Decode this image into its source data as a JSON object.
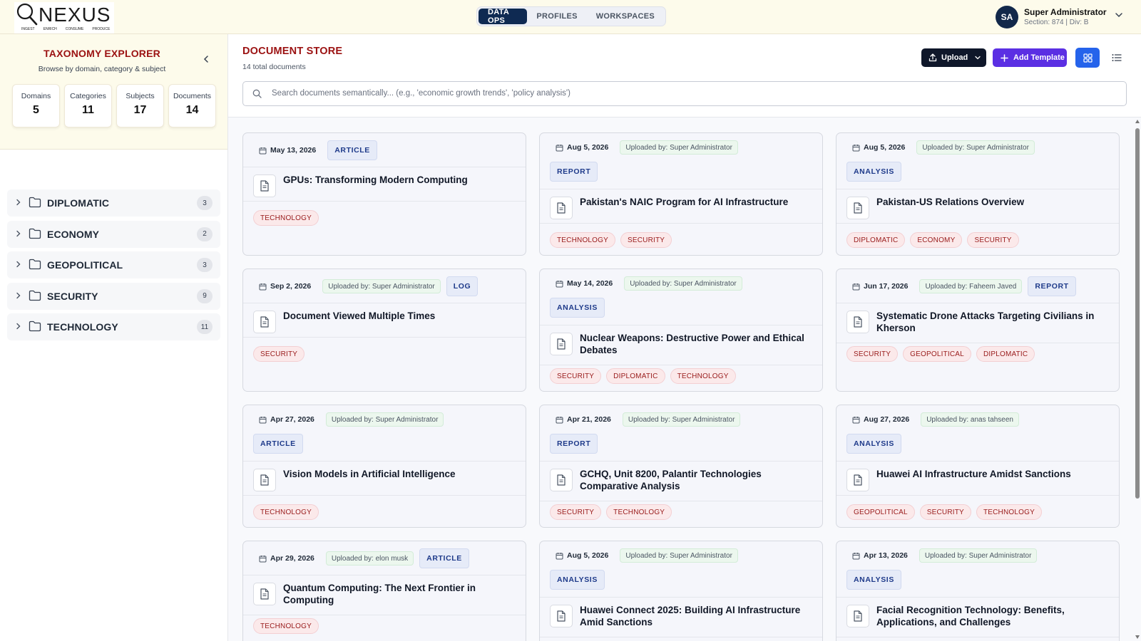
{
  "header": {
    "logo": {
      "name": "NEXUS",
      "tagline": [
        "INGEST",
        "ENRICH",
        "CONSUME",
        "PRODUCE"
      ]
    },
    "tabs": [
      {
        "label": "DATA OPS",
        "active": true
      },
      {
        "label": "PROFILES",
        "active": false
      },
      {
        "label": "WORKSPACES",
        "active": false
      }
    ],
    "user": {
      "initials": "SA",
      "name": "Super Administrator",
      "meta": "Section: 874 | Div: B"
    }
  },
  "sidebar": {
    "title": "TAXONOMY EXPLORER",
    "subtitle": "Browse by domain, category & subject",
    "stats": [
      {
        "label": "Domains",
        "value": "5"
      },
      {
        "label": "Categories",
        "value": "11"
      },
      {
        "label": "Subjects",
        "value": "17"
      },
      {
        "label": "Documents",
        "value": "14"
      }
    ],
    "domains": [
      {
        "label": "DIPLOMATIC",
        "count": "3"
      },
      {
        "label": "ECONOMY",
        "count": "2"
      },
      {
        "label": "GEOPOLITICAL",
        "count": "3"
      },
      {
        "label": "SECURITY",
        "count": "9"
      },
      {
        "label": "TECHNOLOGY",
        "count": "11"
      }
    ]
  },
  "main": {
    "title": "DOCUMENT STORE",
    "count_text": "14 total documents",
    "upload_label": "Upload",
    "add_template_label": "Add Template",
    "search": {
      "placeholder": "Search documents semantically... (e.g., 'economic growth trends', 'policy analysis')",
      "value": ""
    }
  },
  "colors": {
    "brand_red": "#9b1111",
    "nav_active": "#0f2a52",
    "primary": "#2563eb",
    "accent_purple": "#5b2fe3",
    "tag_red": "#991b1b"
  },
  "documents": [
    {
      "date": "May 13, 2026",
      "uploader": "",
      "type": "ARTICLE",
      "type_inline": true,
      "title": "GPUs: Transforming Modern Computing",
      "tags": [
        "TECHNOLOGY"
      ]
    },
    {
      "date": "Aug 5, 2026",
      "uploader": "Uploaded by: Super Administrator",
      "type": "REPORT",
      "type_inline": false,
      "title": "Pakistan's NAIC Program for AI Infrastructure",
      "tags": [
        "TECHNOLOGY",
        "SECURITY"
      ]
    },
    {
      "date": "Aug 5, 2026",
      "uploader": "Uploaded by: Super Administrator",
      "type": "ANALYSIS",
      "type_inline": false,
      "title": "Pakistan-US Relations Overview",
      "tags": [
        "DIPLOMATIC",
        "ECONOMY",
        "SECURITY"
      ]
    },
    {
      "date": "Sep 2, 2026",
      "uploader": "Uploaded by: Super Administrator",
      "type": "LOG",
      "type_inline": true,
      "title": "Document Viewed Multiple Times",
      "tags": [
        "SECURITY"
      ]
    },
    {
      "date": "May 14, 2026",
      "uploader": "Uploaded by: Super Administrator",
      "type": "ANALYSIS",
      "type_inline": false,
      "title": "Nuclear Weapons: Destructive Power and Ethical Debates",
      "tags": [
        "SECURITY",
        "DIPLOMATIC",
        "TECHNOLOGY"
      ]
    },
    {
      "date": "Jun 17, 2026",
      "uploader": "Uploaded by: Faheem Javed",
      "type": "REPORT",
      "type_inline": true,
      "title": "Systematic Drone Attacks Targeting Civilians in Kherson",
      "tags": [
        "SECURITY",
        "GEOPOLITICAL",
        "DIPLOMATIC"
      ]
    },
    {
      "date": "Apr 27, 2026",
      "uploader": "Uploaded by: Super Administrator",
      "type": "ARTICLE",
      "type_inline": false,
      "title": "Vision Models in Artificial Intelligence",
      "tags": [
        "TECHNOLOGY"
      ]
    },
    {
      "date": "Apr 21, 2026",
      "uploader": "Uploaded by: Super Administrator",
      "type": "REPORT",
      "type_inline": false,
      "title": "GCHQ, Unit 8200, Palantir Technologies Comparative Analysis",
      "tags": [
        "SECURITY",
        "TECHNOLOGY"
      ]
    },
    {
      "date": "Aug 27, 2026",
      "uploader": "Uploaded by: anas tahseen",
      "type": "ANALYSIS",
      "type_inline": false,
      "title": "Huawei AI Infrastructure Amidst Sanctions",
      "tags": [
        "GEOPOLITICAL",
        "SECURITY",
        "TECHNOLOGY"
      ]
    },
    {
      "date": "Apr 29, 2026",
      "uploader": "Uploaded by: elon musk",
      "type": "ARTICLE",
      "type_inline": true,
      "title": "Quantum Computing: The Next Frontier in Computing",
      "tags": [
        "TECHNOLOGY"
      ]
    },
    {
      "date": "Aug 5, 2026",
      "uploader": "Uploaded by: Super Administrator",
      "type": "ANALYSIS",
      "type_inline": false,
      "title": "Huawei Connect 2025: Building AI Infrastructure Amid Sanctions",
      "tags": []
    },
    {
      "date": "Apr 13, 2026",
      "uploader": "Uploaded by: Super Administrator",
      "type": "ANALYSIS",
      "type_inline": false,
      "title": "Facial Recognition Technology: Benefits, Applications, and Challenges",
      "tags": []
    }
  ]
}
